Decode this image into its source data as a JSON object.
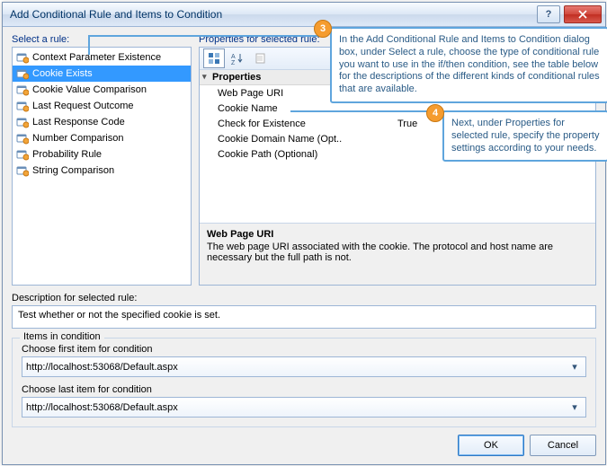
{
  "titlebar": {
    "title": "Add Conditional Rule and Items to Condition"
  },
  "left": {
    "label": "Select a rule:",
    "items": [
      {
        "label": "Context Parameter Existence"
      },
      {
        "label": "Cookie Exists"
      },
      {
        "label": "Cookie Value Comparison"
      },
      {
        "label": "Last Request Outcome"
      },
      {
        "label": "Last Response Code"
      },
      {
        "label": "Number Comparison"
      },
      {
        "label": "Probability Rule"
      },
      {
        "label": "String Comparison"
      }
    ],
    "selected_index": 1
  },
  "right": {
    "label": "Properties for selected rule:",
    "group_header": "Properties",
    "props": [
      {
        "name": "Web Page URI",
        "value": ""
      },
      {
        "name": "Cookie Name",
        "value": ""
      },
      {
        "name": "Check for Existence",
        "value": "True"
      },
      {
        "name": "Cookie Domain Name (Opt..",
        "value": ""
      },
      {
        "name": "Cookie Path (Optional)",
        "value": ""
      }
    ],
    "help_title": "Web Page URI",
    "help_text": "The web page URI associated with the cookie. The protocol and host name are necessary but the full path is not."
  },
  "desc": {
    "label": "Description for selected rule:",
    "text": "Test whether or not the specified cookie is set."
  },
  "items_cond": {
    "legend": "Items in condition",
    "first_label": "Choose first item for condition",
    "first_value": "http://localhost:53068/Default.aspx",
    "last_label": "Choose last item for condition",
    "last_value": "http://localhost:53068/Default.aspx"
  },
  "buttons": {
    "ok": "OK",
    "cancel": "Cancel"
  },
  "callouts": {
    "c3": {
      "num": "3",
      "text": "In the Add Conditional Rule and Items to Condition dialog box, under Select a rule, choose the type of conditional rule you want to use in the if/then condition, see the table below for the descriptions of the different kinds of conditional rules that are available."
    },
    "c4": {
      "num": "4",
      "text": "Next, under Properties for selected rule, specify the property settings according to your needs."
    }
  }
}
